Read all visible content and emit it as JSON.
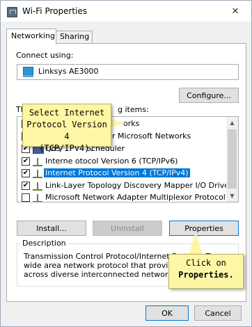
{
  "window": {
    "title": "Wi-Fi Properties",
    "close_glyph": "✕"
  },
  "tabs": [
    {
      "label": "Networking",
      "active": true
    },
    {
      "label": "Sharing",
      "active": false
    }
  ],
  "connect_using": {
    "label": "Connect using:",
    "adapter": "Linksys AE3000",
    "configure_label": "Configure..."
  },
  "items_label_visible": "This connection uses the following items:",
  "items_label_parts": {
    "prefix": "Th",
    "suffix": "g items:"
  },
  "items": [
    {
      "text": "Client for Microsoft Networks",
      "visible": "orks",
      "checked": true,
      "icon": "network-client-icon"
    },
    {
      "text": "File and Printer Sharing for Microsoft Networks",
      "visible": "r Microsoft Networks",
      "checked": true,
      "icon": "network-service-icon"
    },
    {
      "text": "QoS Packet Scheduler",
      "visible_left": "QoS",
      "visible_right": "Scheduler",
      "checked": true,
      "icon": "network-service-icon"
    },
    {
      "text": "Internet Protocol Version 6 (TCP/IPv6)",
      "visible": "Interne   otocol Version 6 (TCP/IPv6)",
      "checked": true,
      "icon": "protocol-icon"
    },
    {
      "text": "Internet Protocol Version 4 (TCP/IPv4)",
      "visible": "Internet Protocol Version 4 (TCP/IPv4)",
      "checked": true,
      "selected": true,
      "icon": "protocol-icon"
    },
    {
      "text": "Link-Layer Topology Discovery Mapper I/O Driver",
      "visible": "Link-Layer Topology Discovery Mapper I/O Driver",
      "checked": true,
      "icon": "protocol-icon"
    },
    {
      "text": "Microsoft Network Adapter Multiplexor Protocol",
      "visible": "Microsoft Network Adapter Multiplexor Protocol",
      "checked": false,
      "icon": "protocol-icon"
    }
  ],
  "buttons": {
    "install": "Install...",
    "uninstall": "Uninstall",
    "properties": "Properties"
  },
  "description": {
    "title": "Description",
    "line1": "Transmission Control Protocol/Internet Protoc",
    "line1_tail": "T",
    "line2": "wide area network protocol that provides co",
    "line3": "across diverse interconnected networks."
  },
  "callouts": {
    "select_line1": "Select Internet",
    "select_line2": "Protocol Version 4",
    "select_line3": "(TCP/IPv4).",
    "click_line1": "Click on",
    "click_line2": "Properties."
  },
  "footer": {
    "ok": "OK",
    "cancel": "Cancel"
  },
  "colors": {
    "accent": "#0078d7",
    "callout": "#fdf7a5"
  }
}
